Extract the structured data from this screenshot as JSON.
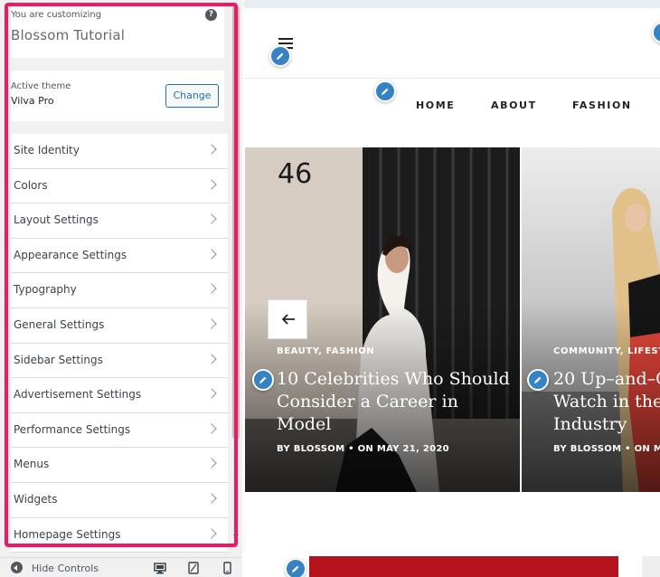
{
  "customizer": {
    "customizing_label": "You are customizing",
    "site_title": "Blossom Tutorial",
    "help_icon": "question-icon",
    "theme": {
      "active_label": "Active theme",
      "name": "Vilva Pro",
      "change_label": "Change"
    },
    "sections": [
      "Site Identity",
      "Colors",
      "Layout Settings",
      "Appearance Settings",
      "Typography",
      "General Settings",
      "Sidebar Settings",
      "Advertisement Settings",
      "Performance Settings",
      "Menus",
      "Widgets",
      "Homepage Settings"
    ],
    "footer": {
      "hide_label": "Hide Controls",
      "devices": [
        "desktop-icon",
        "tablet-icon",
        "mobile-icon"
      ]
    },
    "highlight_color": "#f0185f"
  },
  "preview": {
    "nav": [
      "HOME",
      "ABOUT",
      "FASHION"
    ],
    "slides": [
      {
        "categories": "BEAUTY,  FASHION",
        "title_lines": [
          "10 Celebrities Who Should",
          "Consider a Career in",
          "Model"
        ],
        "meta": "BY BLOSSOM  •  ON MAY 21, 2020",
        "house_number": "46"
      },
      {
        "categories": "COMMUNITY,  LIFEST",
        "title_lines": [
          "20 Up–and–C",
          "Watch in the",
          "Industry"
        ],
        "meta": "BY BLOSSOM  •  ON M"
      }
    ],
    "accent_color": "#3582c4"
  }
}
